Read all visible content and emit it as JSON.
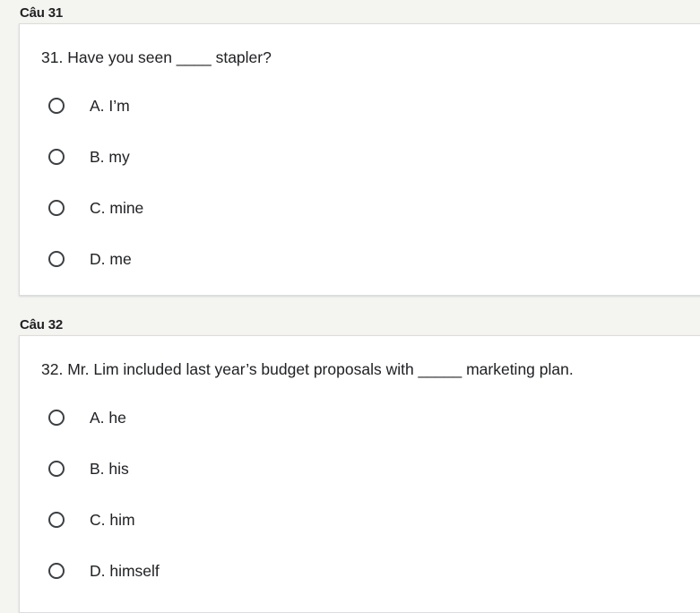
{
  "questions": [
    {
      "header": "Câu 31",
      "text": "31. Have you seen ____ stapler?",
      "options": [
        {
          "label": "A. I’m",
          "selected": false
        },
        {
          "label": "B. my",
          "selected": false
        },
        {
          "label": "C. mine",
          "selected": false
        },
        {
          "label": "D. me",
          "selected": false
        }
      ]
    },
    {
      "header": "Câu 32",
      "text": "32. Mr. Lim included last year’s budget proposals with _____ marketing plan.",
      "options": [
        {
          "label": "A. he",
          "selected": false
        },
        {
          "label": "B. his",
          "selected": false
        },
        {
          "label": "C. him",
          "selected": false
        },
        {
          "label": "D. himself",
          "selected": false
        }
      ]
    }
  ]
}
